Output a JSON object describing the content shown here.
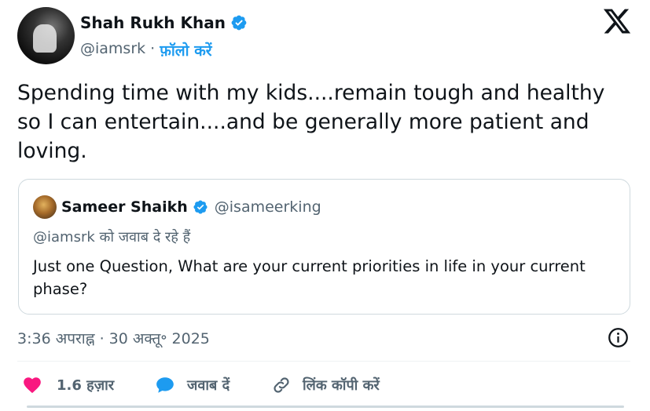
{
  "author": {
    "name": "Shah Rukh Khan",
    "handle": "@iamsrk",
    "separator": "·",
    "follow_label": "फ़ॉलो करें"
  },
  "tweet": {
    "text": "Spending time with my kids....remain tough and healthy so I can entertain....and be generally more patient and loving."
  },
  "quote": {
    "name": "Sameer Shaikh",
    "handle": "@isameerking",
    "reply_to": "@iamsrk को जवाब दे रहे हैं",
    "text": "Just one Question, What are your current priorities in life in your current phase?"
  },
  "timestamp": "3:36 अपराह्न · 30 अक्तू॰ 2025",
  "actions": {
    "likes": "1.6 हज़ार",
    "reply": "जवाब दें",
    "copy_link": "लिंक कॉपी करें"
  },
  "colors": {
    "accent": "#1d9bf0",
    "like": "#f91880",
    "text": "#0f1419",
    "secondary": "#536471",
    "border": "#cfd9de"
  },
  "icons": [
    "x-logo-icon",
    "verified-badge-icon",
    "info-icon",
    "heart-icon",
    "reply-icon",
    "link-icon"
  ]
}
